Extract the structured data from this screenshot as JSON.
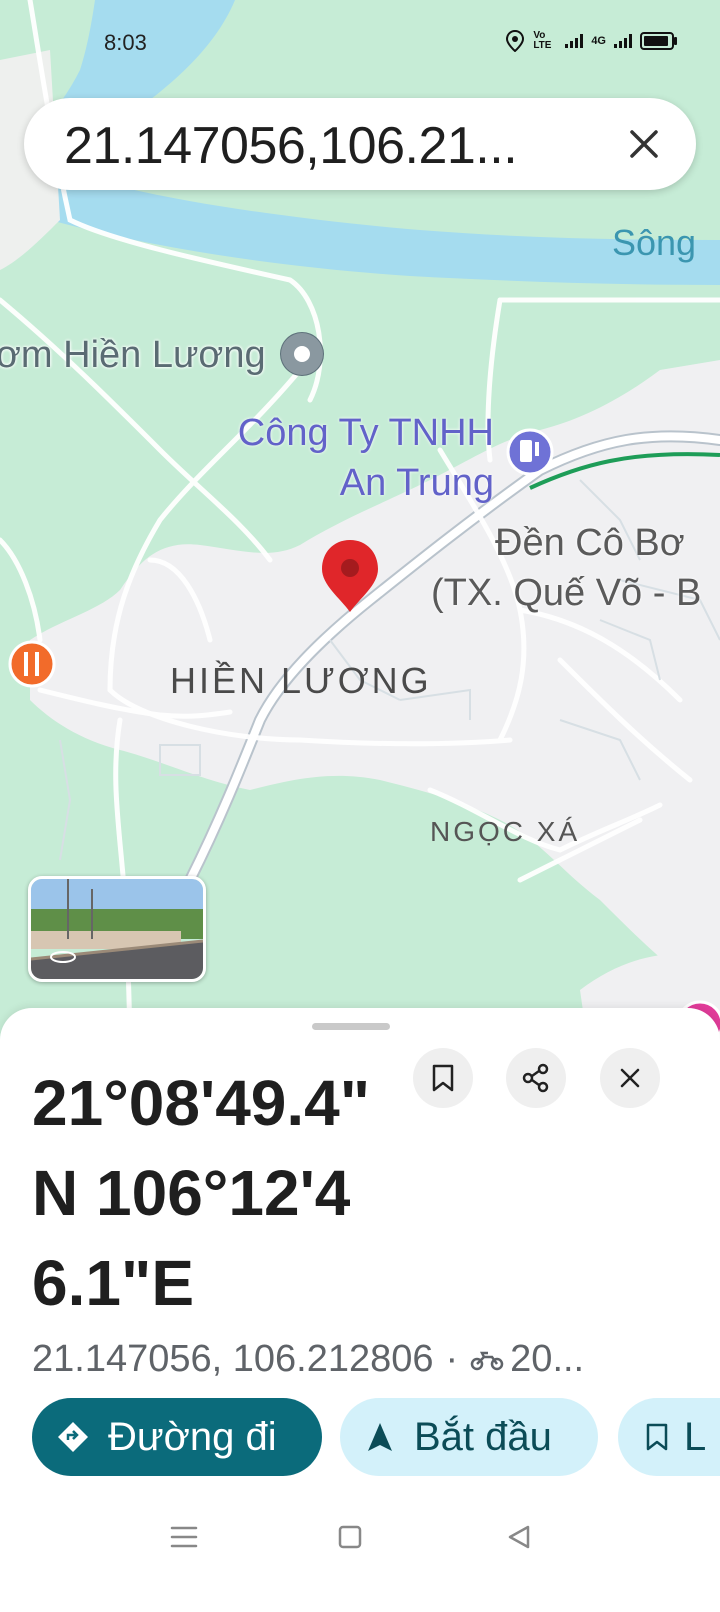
{
  "status_bar": {
    "time": "8:03",
    "network_label": "4G",
    "volte_label": "Vo LTE"
  },
  "search": {
    "query": "21.147056,106.21..."
  },
  "map": {
    "labels": {
      "poi_name": "ơm Hiền Lương",
      "business_line1": "Công Ty TNHH",
      "business_line2": "An Trung",
      "place_line1": "Đền Cô Bơ",
      "place_line2": "(TX. Quế Võ - B",
      "area_main": "HIỀN LƯƠNG",
      "area_secondary": "NGỌC XÁ",
      "water": "Sông"
    },
    "colors": {
      "land": "#c6ecd6",
      "water": "#a5dcef",
      "urban": "#f0f0f2",
      "road": "#ffffff",
      "pin": "#e0262a"
    }
  },
  "sheet": {
    "title": "21°08'49.4\" N 106°12'46.1\"E",
    "coordinates": "21.147056, 106.212806",
    "travel": "20...",
    "actions": {
      "directions": "Đường đi",
      "start": "Bắt đầu",
      "save": "L"
    }
  },
  "icons": {
    "search_close": "close-icon",
    "save": "bookmark-icon",
    "share": "share-icon",
    "close": "close-icon",
    "directions": "directions-icon",
    "start": "navigation-arrow-icon",
    "travel_mode": "motorbike-icon"
  }
}
